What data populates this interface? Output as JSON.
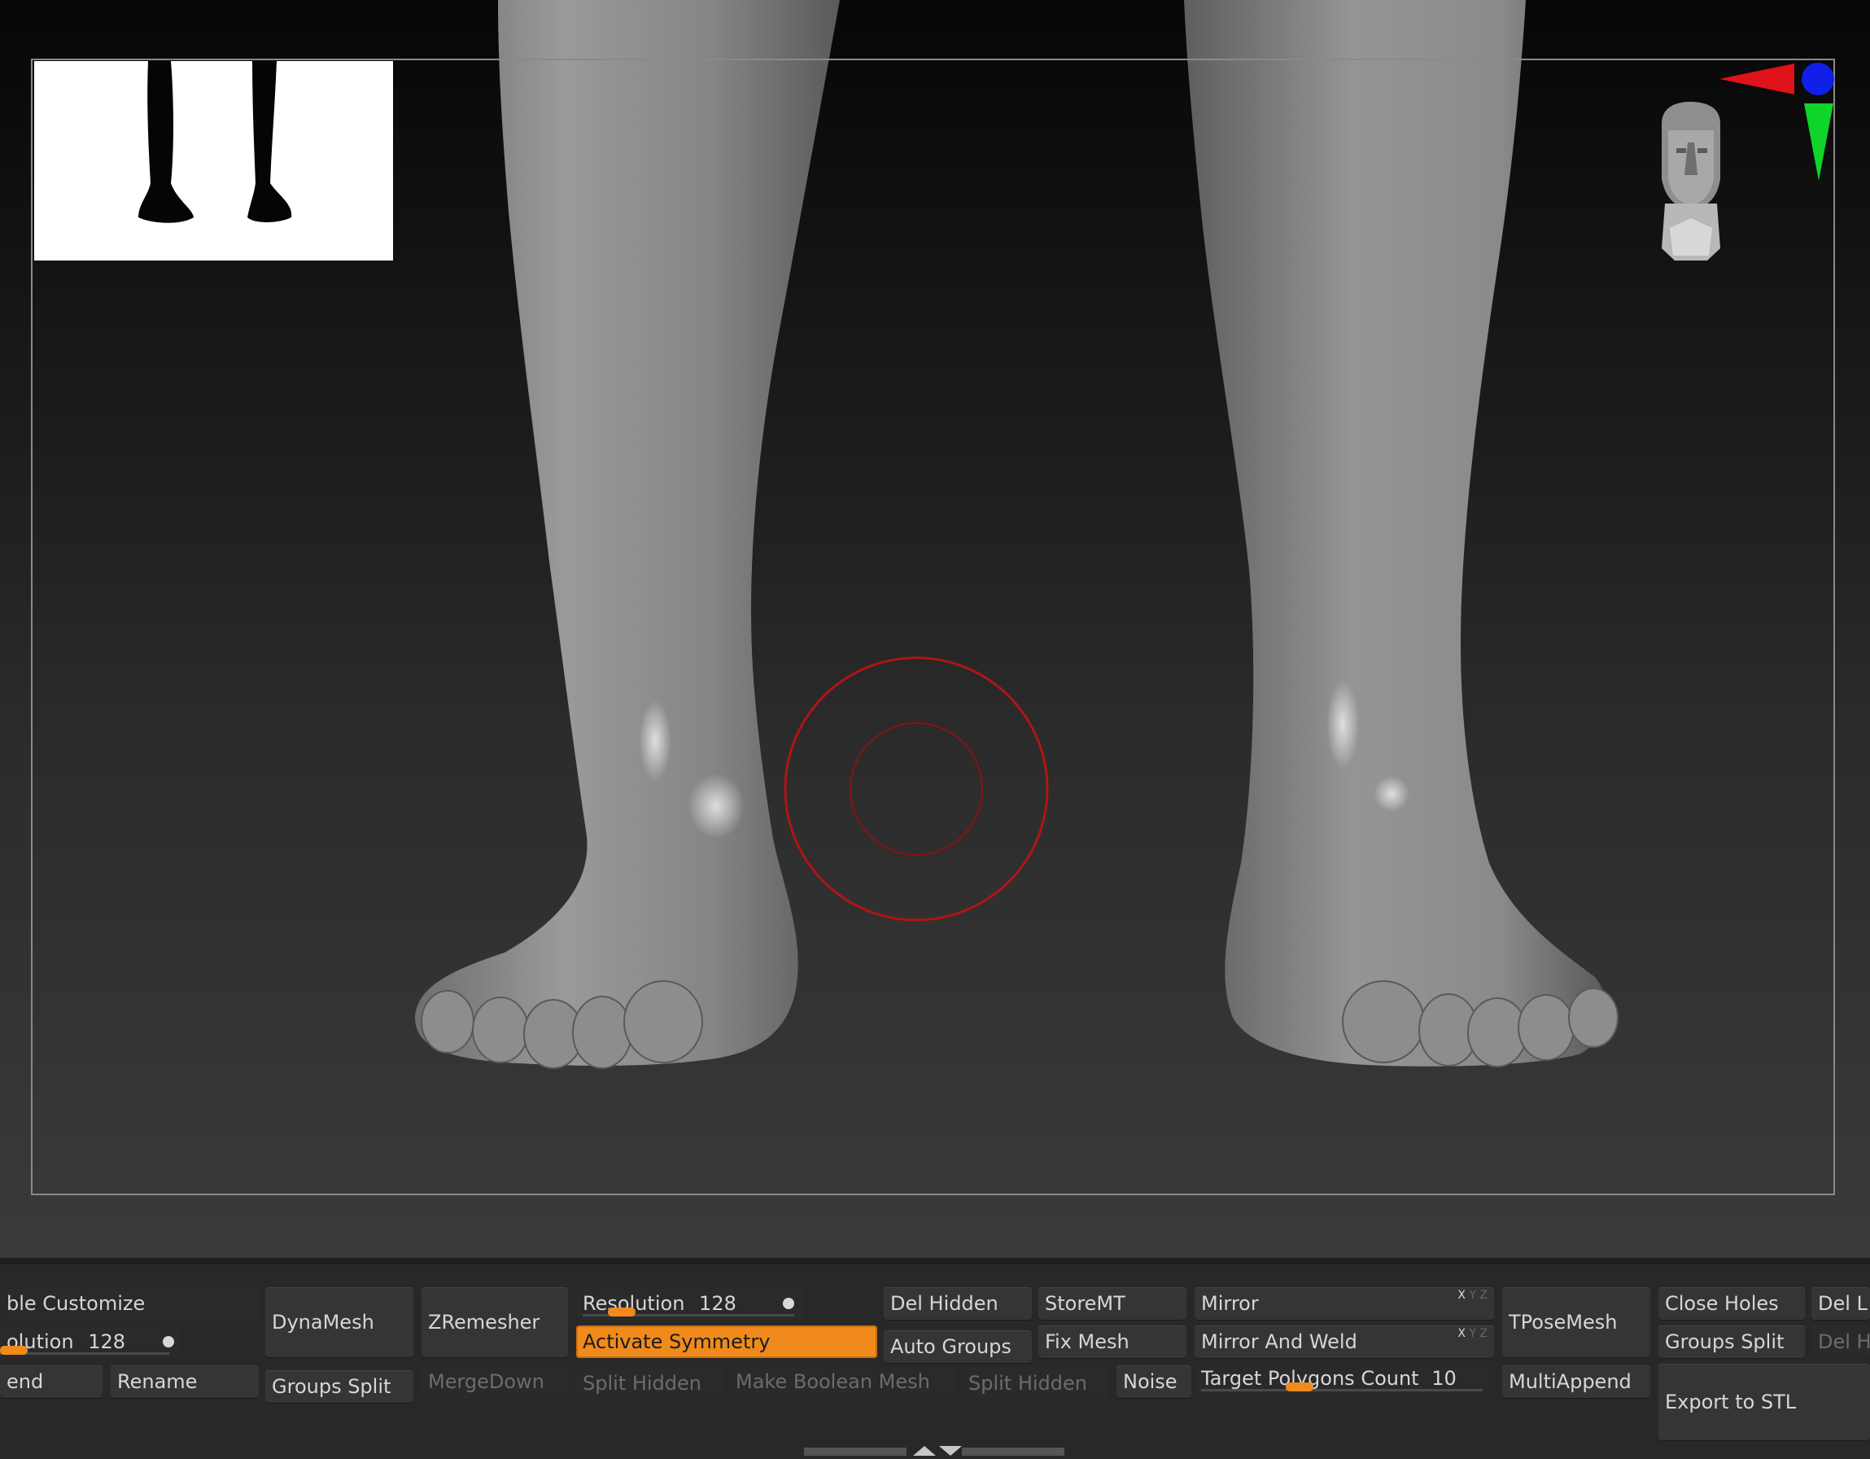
{
  "toolbar": {
    "row1": {
      "enable_customize": "ble Customize",
      "dynamesh": "DynaMesh",
      "zremesher": "ZRemesher",
      "resolution_label": "Resolution",
      "resolution_value": "128",
      "del_hidden": "Del Hidden",
      "storemt": "StoreMT",
      "mirror": "Mirror",
      "tposemesh": "TPoseMesh",
      "close_holes": "Close Holes",
      "del_partial": "Del L"
    },
    "row2": {
      "resolution_label": "olution",
      "resolution_value": "128",
      "activate_symmetry": "Activate Symmetry",
      "auto_groups": "Auto Groups",
      "fix_mesh": "Fix Mesh",
      "mirror_and_weld": "Mirror And Weld",
      "groups_split": "Groups Split",
      "del_hidden_partial": "Del H"
    },
    "row3": {
      "append_partial": "end",
      "rename": "Rename",
      "groups_split": "Groups Split",
      "mergedown": "MergeDown",
      "split_hidden": "Split Hidden",
      "make_boolean_mesh": "Make Boolean Mesh",
      "split_hidden_2": "Split Hidden",
      "noise": "Noise",
      "target_polygons_label": "Target Polygons Count",
      "target_polygons_value": "10",
      "multiappend": "MultiAppend",
      "export_to_stl": "Export to STL"
    },
    "xyz": {
      "x": "X",
      "y": "Y",
      "z": "Z"
    },
    "sliders": {
      "resolution_fraction": 0.0,
      "dynamesh_resolution_fraction": 0.2,
      "target_polygons_fraction": 0.3
    }
  },
  "colors": {
    "accent_orange": "#f08a1c",
    "brush_cursor": "#b01515",
    "axis_x": "#e0121a",
    "axis_y": "#0fd42a",
    "axis_z": "#1020e8"
  },
  "icons": {
    "navigation": "navigation-head-icon",
    "brush": "brush-cursor-icon",
    "grip": "panel-resize-grip-icon"
  }
}
